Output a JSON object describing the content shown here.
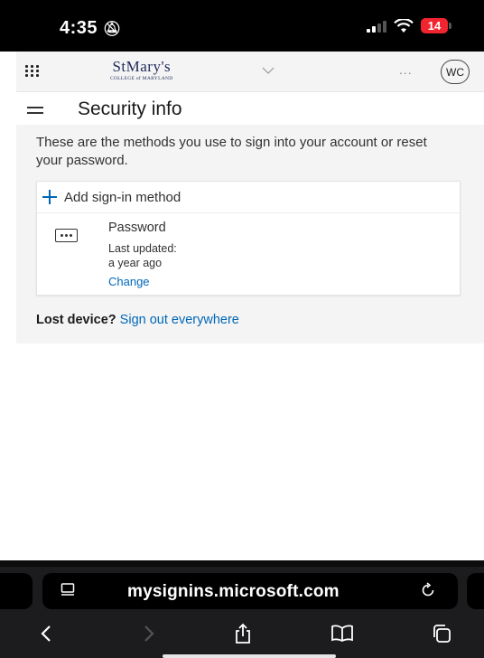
{
  "status_bar": {
    "time": "4:35",
    "battery_level": "14",
    "battery_color": "#f2242f"
  },
  "header": {
    "logo_main": "StMary's",
    "logo_sub": "COLLEGE of MARYLAND",
    "more_label": "...",
    "avatar_initials": "WC"
  },
  "page": {
    "title": "Security info",
    "intro": "These are the methods you use to sign into your account or reset your password.",
    "add_method_label": "Add sign-in method",
    "method": {
      "name": "Password",
      "updated_label": "Last updated:",
      "updated_value": "a year ago",
      "change_label": "Change"
    },
    "lost_device_label": "Lost device?",
    "sign_out_link": "Sign out everywhere"
  },
  "browser": {
    "url": "mysignins.microsoft.com"
  },
  "colors": {
    "accent": "#0067b8",
    "panel_bg": "#f4f4f4",
    "toolbar_bg": "#1c1c1e"
  }
}
